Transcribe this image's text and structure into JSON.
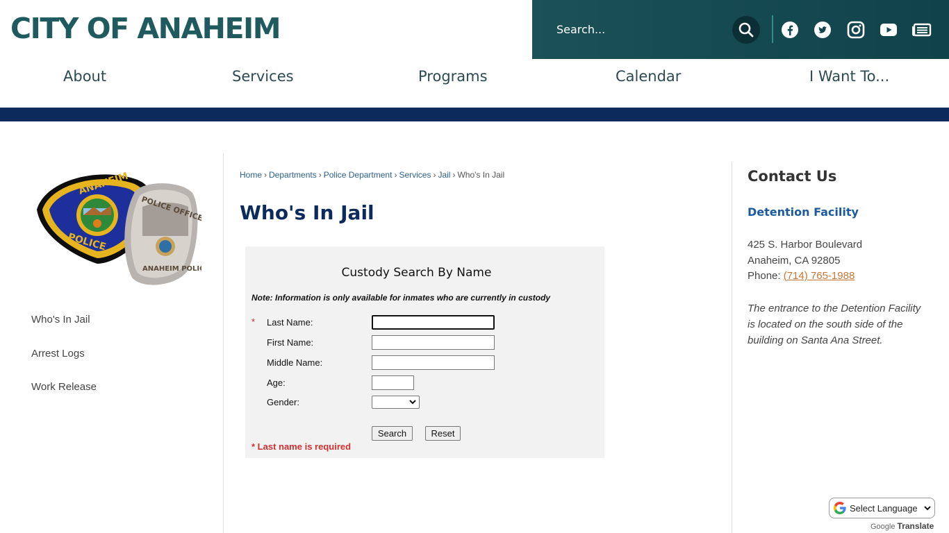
{
  "header": {
    "logo_text": "CITY OF ANAHEIM",
    "search_placeholder": "Search...",
    "social_icons": [
      "facebook-icon",
      "twitter-icon",
      "instagram-icon",
      "youtube-icon",
      "news-icon"
    ]
  },
  "nav": {
    "items": [
      "About",
      "Services",
      "Programs",
      "Calendar",
      "I Want To..."
    ]
  },
  "sidebar": {
    "links": [
      "Who's In Jail",
      "Arrest Logs",
      "Work Release"
    ]
  },
  "breadcrumb": {
    "items": [
      "Home",
      "Departments",
      "Police Department",
      "Services",
      "Jail"
    ],
    "current": "Who's In Jail",
    "separator": "›"
  },
  "page": {
    "title": "Who's In Jail"
  },
  "form": {
    "title": "Custody Search By Name",
    "note": "Note: Information is only available for inmates who are currently in custody",
    "required_marker": "*",
    "fields": {
      "last_name": {
        "label": "Last Name:",
        "value": ""
      },
      "first_name": {
        "label": "First Name:",
        "value": ""
      },
      "middle_name": {
        "label": "Middle Name:",
        "value": ""
      },
      "age": {
        "label": "Age:",
        "value": ""
      },
      "gender": {
        "label": "Gender:",
        "value": ""
      }
    },
    "search_button": "Search",
    "reset_button": "Reset",
    "required_message": "* Last name is required"
  },
  "contact": {
    "title": "Contact Us",
    "subtitle": "Detention Facility",
    "address1": "425 S. Harbor Boulevard",
    "address2": "Anaheim, CA 92805",
    "phone_label": "Phone:",
    "phone": "(714) 765-1988",
    "note": "The entrance to the Detention Facility is located on the south side of the building on Santa Ana Street."
  },
  "translate": {
    "label": "Select Language",
    "powered_by": "Google",
    "powered_text": "Translate"
  },
  "colors": {
    "brand_teal": "#1f5b5e",
    "navy": "#0d2a5c",
    "link_blue": "#1b5aa0",
    "required_red": "#d32f2f",
    "phone_orange": "#c87533"
  }
}
